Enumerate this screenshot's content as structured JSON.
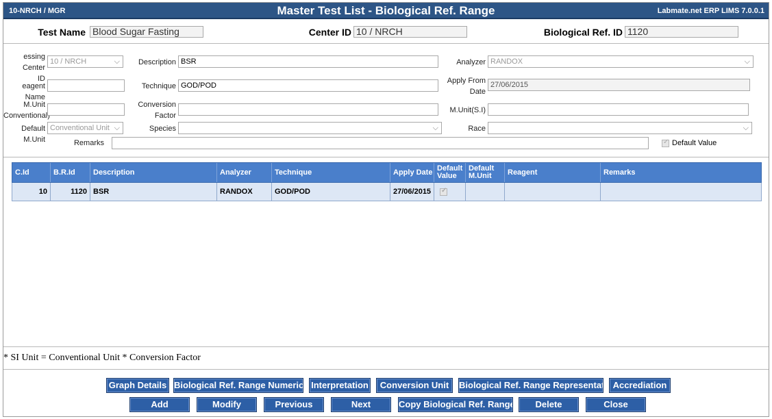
{
  "titlebar": {
    "location": "10-NRCH / MGR",
    "title": "Master Test List - Biological Ref. Range",
    "product": "Labmate.net ERP LIMS 7.0.0.1"
  },
  "header": {
    "test_name_label": "Test Name",
    "test_name_value": "Blood Sugar Fasting",
    "center_id_label": "Center ID",
    "center_id_value": "10 / NRCH",
    "bio_ref_id_label": "Biological Ref. ID",
    "bio_ref_id_value": "1120"
  },
  "form": {
    "processing_center_label_1": "essing Center",
    "processing_center_label_2": "ID",
    "processing_center_value": "10 / NRCH",
    "description_label": "Description",
    "description_value": "BSR",
    "analyzer_label": "Analyzer",
    "analyzer_value": "RANDOX",
    "reagent_label": "eagent Name",
    "reagent_value": "",
    "technique_label": "Technique",
    "technique_value": "GOD/POD",
    "apply_from_label_1": "Apply From",
    "apply_from_label_2": "Date",
    "apply_from_value": "27/06/2015",
    "munit_conv_label_1": "M.Unit",
    "munit_conv_label_2": "Conventional)",
    "munit_conv_value": "",
    "conversion_label_1": "Conversion",
    "conversion_label_2": "Factor",
    "conversion_value": "",
    "munit_si_label": "M.Unit(S.I)",
    "munit_si_value": "",
    "default_munit_label": "Default M.Unit",
    "default_munit_value": "Conventional Unit",
    "species_label": "Species",
    "species_value": "",
    "race_label": "Race",
    "race_value": "",
    "remarks_label": "Remarks",
    "remarks_value": "",
    "default_value_label": "Default Value"
  },
  "grid": {
    "columns": [
      "C.Id",
      "B.R.Id",
      "Description",
      "Analyzer",
      "Technique",
      "Apply Date",
      "Default Value",
      "Default M.Unit",
      "Reagent",
      "Remarks"
    ],
    "rows": [
      {
        "cid": "10",
        "brid": "1120",
        "description": "BSR",
        "analyzer": "RANDOX",
        "technique": "GOD/POD",
        "apply_date": "27/06/2015",
        "default_munit": "",
        "reagent": "",
        "remarks": ""
      }
    ]
  },
  "note": "* SI Unit = Conventional Unit * Conversion Factor",
  "buttons_row1": [
    "Graph Details",
    "Biological Ref. Range Numeric",
    "Interpretation",
    "Conversion Unit",
    "Biological Ref. Range Representation",
    "Accrediation"
  ],
  "buttons_row2": [
    "Add",
    "Modify",
    "Previous",
    "Next",
    "Copy Biological Ref. Range",
    "Delete",
    "Close"
  ]
}
